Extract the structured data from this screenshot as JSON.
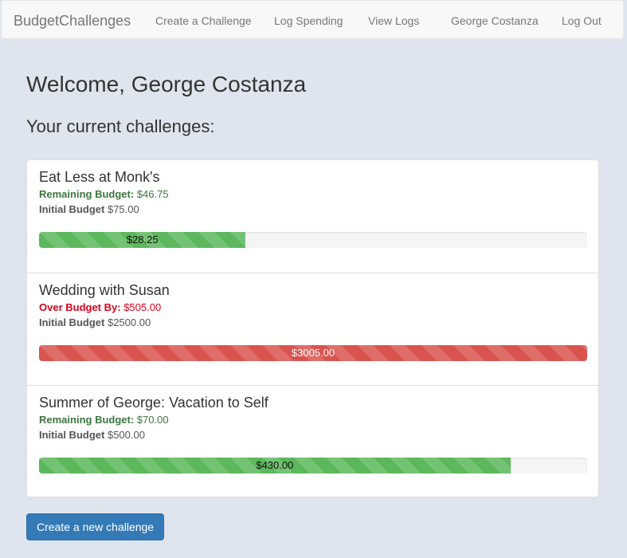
{
  "nav": {
    "brand": "BudgetChallenges",
    "links": [
      "Create a Challenge",
      "Log Spending",
      "View Logs",
      "George Costanza",
      "Log Out"
    ]
  },
  "welcome": "Welcome, George Costanza",
  "subheading": "Your current challenges:",
  "challenges": [
    {
      "title": "Eat Less at Monk's",
      "status_label": "Remaining Budget:",
      "status_value": "$46.75",
      "status": "remaining",
      "initial_label": "Initial Budget",
      "initial_value": "$75.00",
      "bar_label": "$28.25",
      "progress_percent": 37.7
    },
    {
      "title": "Wedding with Susan",
      "status_label": "Over Budget By:",
      "status_value": "$505.00",
      "status": "over",
      "initial_label": "Initial Budget",
      "initial_value": "$2500.00",
      "bar_label": "$3005.00",
      "progress_percent": 100
    },
    {
      "title": "Summer of George: Vacation to Self",
      "status_label": "Remaining Budget:",
      "status_value": "$70.00",
      "status": "remaining",
      "initial_label": "Initial Budget",
      "initial_value": "$500.00",
      "bar_label": "$430.00",
      "progress_percent": 86
    }
  ],
  "create_button": "Create a new challenge",
  "colors": {
    "success": "#5cb85c",
    "danger": "#d9534f",
    "primary": "#337ab7",
    "page_background": "#dfe5ee"
  }
}
